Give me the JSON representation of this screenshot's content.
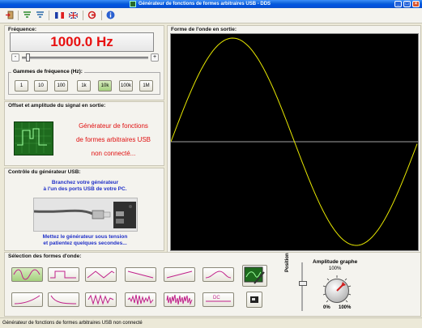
{
  "window": {
    "title": "Générateur de fonctions de formes arbitraires USB - DDS",
    "minimize": "_",
    "maximize": "□",
    "close": "×"
  },
  "toolbar": {
    "icons": [
      "exit-icon",
      "filter-icon",
      "filter-alt-icon",
      "flag-fr-icon",
      "flag-uk-icon",
      "brand-icon",
      "info-icon"
    ]
  },
  "frequency": {
    "title": "Fréquence:",
    "value": "1000.0 Hz",
    "minus": "-",
    "plus": "+"
  },
  "ranges": {
    "title": "Gammes de fréquence (Hz):",
    "buttons": [
      "1",
      "10",
      "100",
      "1k",
      "10k",
      "100k",
      "1M"
    ],
    "selected": "10k"
  },
  "offset": {
    "title": "Offset et amplitude du signal en sortie:",
    "line1": "Générateur de fonctions",
    "line2": "de formes arbitraires USB",
    "line3": "non connecté..."
  },
  "usb": {
    "title": "Contrôle du générateur USB:",
    "instr1a": "Branchez votre générateur",
    "instr1b": "à l'un des ports USB de votre PC.",
    "instr2a": "Mettez le générateur sous tension",
    "instr2b": "et patientez quelques secondes..."
  },
  "scope": {
    "title": "Forme de l'onde en sortie:",
    "trace_color": "#e8e800"
  },
  "waveforms": {
    "title": "Sélection des formes d'onde:",
    "row1": [
      "sine",
      "square",
      "triangle",
      "ramp-down",
      "ramp-up",
      "pulse"
    ],
    "row2": [
      "exp-rise",
      "exp-decay",
      "burst",
      "am",
      "noise"
    ],
    "dc_label": "DC",
    "selected": "sine"
  },
  "position": {
    "label": "Position"
  },
  "amplitude": {
    "title": "Amplitude graphe",
    "max_label": "100%",
    "min_scale": "0%",
    "max_scale": "100%"
  },
  "status": {
    "text": "Générateur de fonctions de formes arbitraires USB non connecté"
  }
}
